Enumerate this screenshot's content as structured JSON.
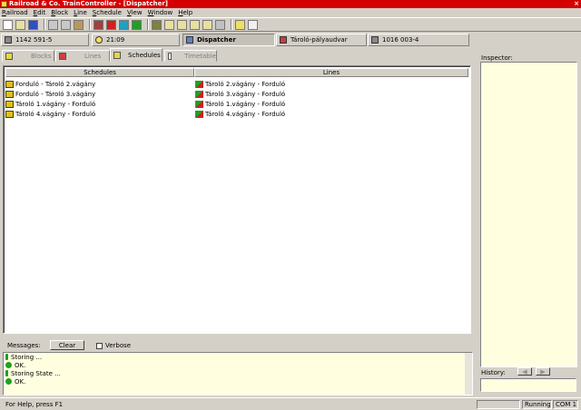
{
  "window": {
    "title": "Railroad & Co. TrainController - [Dispatcher]"
  },
  "menu": [
    "Railroad",
    "Edit",
    "Block",
    "Line",
    "Schedule",
    "View",
    "Window",
    "Help"
  ],
  "statusrow": {
    "loco1": "1142 591-5",
    "clock": "21:09",
    "mode": "Dispatcher",
    "station": "Tároló-pályaudvar",
    "loco2": "1016 003-4"
  },
  "tabs": [
    "Blocks",
    "Lines",
    "Schedules",
    "Timetable"
  ],
  "table": {
    "headers": [
      "Schedules",
      "Lines"
    ],
    "rows": [
      {
        "schedule": "Forduló - Tároló 2.vágány",
        "line": "Tároló 2.vágány - Forduló"
      },
      {
        "schedule": "Forduló - Tároló 3.vágány",
        "line": "Tároló 3.vágány - Forduló"
      },
      {
        "schedule": "Tároló 1.vágány - Forduló",
        "line": "Tároló 1.vágány - Forduló"
      },
      {
        "schedule": "Tároló 4.vágány - Forduló",
        "line": "Tároló 4.vágány - Forduló"
      }
    ]
  },
  "messages": {
    "label": "Messages:",
    "clear": "Clear",
    "verbose": "Verbose",
    "lines": [
      {
        "text": "Storing ...",
        "type": "info"
      },
      {
        "text": "OK.",
        "type": "ok"
      },
      {
        "text": "Storing State ...",
        "type": "info"
      },
      {
        "text": "OK.",
        "type": "ok"
      }
    ]
  },
  "inspector": {
    "label": "Inspector:",
    "history": "History:"
  },
  "statusbar": {
    "help": "For Help, press F1",
    "state": "Running",
    "port": "COM 1"
  },
  "colors": {
    "title": "#d40000",
    "pane": "#ffffe0"
  }
}
